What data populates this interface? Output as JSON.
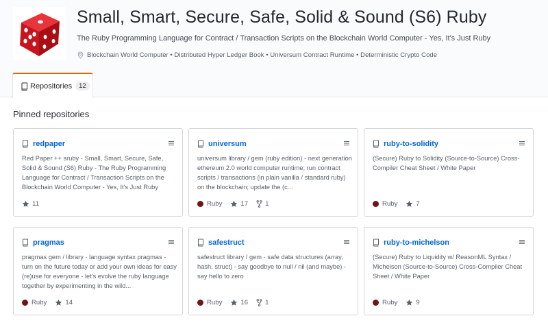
{
  "org": {
    "title": "Small, Smart, Secure, Safe, Solid & Sound (S6) Ruby",
    "description": "The Ruby Programming Language for Contract / Transaction Scripts on the Blockchain World Computer - Yes, It's Just Ruby",
    "location": "Blockchain World Computer • Distributed Hyper Ledger Book • Universum Contract Runtime • Deterministic Crypto Code"
  },
  "tabs": [
    {
      "label": "Repositories",
      "count": "12"
    }
  ],
  "pinned_title": "Pinned repositories",
  "colors": {
    "ruby": "#701516",
    "link": "#0366d6",
    "tab_accent": "#e36209"
  },
  "repos": [
    {
      "name": "redpaper",
      "description": "Red Paper ++ sruby - Small, Smart, Secure, Safe, Solid & Sound (S6) Ruby - The Ruby Programming Language for Contract / Transaction Scripts on the Blockchain World Computer - Yes, It's Just Ruby",
      "language": "",
      "stars": "11",
      "forks": ""
    },
    {
      "name": "universum",
      "description": "universum library / gem (ruby edition) - next generation ethereum 2.0 world computer runtime; run contract scripts / transactions (in plain vanilla / standard ruby) on the blockchain; update the (c...",
      "language": "Ruby",
      "stars": "17",
      "forks": "1"
    },
    {
      "name": "ruby-to-solidity",
      "description": "(Secure) Ruby to Solidity (Source-to-Source) Cross-Compiler Cheat Sheet / White Paper",
      "language": "Ruby",
      "stars": "7",
      "forks": ""
    },
    {
      "name": "pragmas",
      "description": "pragmas gem / library - language syntax pragmas - turn on the future today or add your own ideas for easy (re)use for everyone - let's evolve the ruby language together by experimenting in the wild...",
      "language": "Ruby",
      "stars": "14",
      "forks": ""
    },
    {
      "name": "safestruct",
      "description": "safestruct library / gem - safe data structures (array, hash, struct) - say goodbye to null / nil (and maybe) - say hello to zero",
      "language": "Ruby",
      "stars": "16",
      "forks": "1"
    },
    {
      "name": "ruby-to-michelson",
      "description": "(Secure) Ruby to Liquidity w/ ReasonML Syntax / Michelson (Source-to-Source) Cross-Compiler Cheat Sheet / White Paper",
      "language": "Ruby",
      "stars": "9",
      "forks": ""
    }
  ]
}
